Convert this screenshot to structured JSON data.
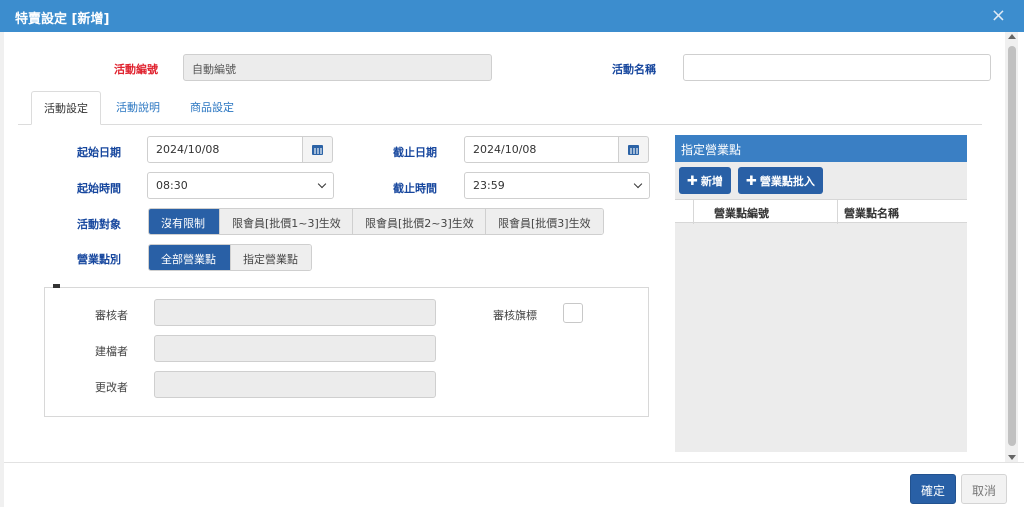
{
  "window": {
    "title": "特賣設定 [新增]",
    "close_icon": "×"
  },
  "header": {
    "activity_id_label": "活動編號",
    "activity_id_value": "自動編號",
    "activity_name_label": "活動名稱",
    "activity_name_value": ""
  },
  "tabs": [
    {
      "label": "活動設定",
      "active": true
    },
    {
      "label": "活動說明",
      "active": false
    },
    {
      "label": "商品設定",
      "active": false
    }
  ],
  "form": {
    "start_date_label": "起始日期",
    "start_date_value": "2024/10/08",
    "end_date_label": "截止日期",
    "end_date_value": "2024/10/08",
    "start_time_label": "起始時間",
    "start_time_value": "08:30",
    "end_time_label": "截止時間",
    "end_time_value": "23:59",
    "target_label": "活動對象",
    "target_options": [
      "沒有限制",
      "限會員[批價1~3]生效",
      "限會員[批價2~3]生效",
      "限會員[批價3]生效"
    ],
    "target_selected": 0,
    "store_type_label": "營業點別",
    "store_type_options": [
      "全部營業點",
      "指定營業點"
    ],
    "store_type_selected": 0
  },
  "audit": {
    "reviewer_label": "審核者",
    "reviewer_value": "",
    "creator_label": "建檔者",
    "creator_value": "",
    "modifier_label": "更改者",
    "modifier_value": "",
    "review_flag_label": "審核旗標",
    "review_flag_checked": false
  },
  "store_panel": {
    "title": "指定營業點",
    "add_label": "新增",
    "batch_add_label": "營業點批入",
    "columns": [
      "營業點編號",
      "營業點名稱"
    ],
    "rows": []
  },
  "footer": {
    "confirm_label": "確定",
    "cancel_label": "取消"
  },
  "colors": {
    "titlebar": "#3c8dce",
    "primary": "#2960a6",
    "label_blue": "#17479e",
    "required_red": "#e0232f"
  }
}
